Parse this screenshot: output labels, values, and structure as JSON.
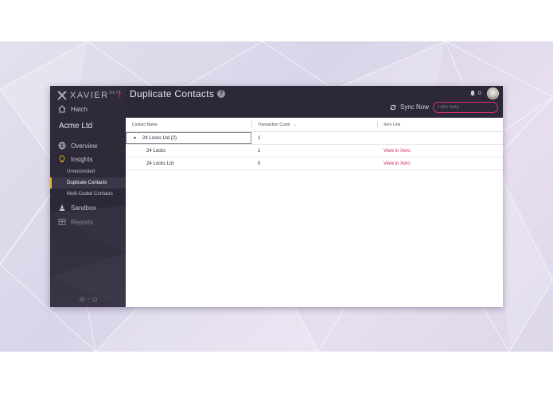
{
  "brand": {
    "name": "XAVIER",
    "badge": "BETA",
    "collapse_glyph": "‹"
  },
  "sidebar": {
    "home": {
      "label": "Hatch",
      "icon": "home-icon"
    },
    "org_name": "Acme Ltd",
    "overview": {
      "label": "Overview",
      "icon": "globe-icon"
    },
    "insights": {
      "label": "Insights",
      "icon": "lightbulb-icon",
      "children": [
        {
          "label": "Unreconciled",
          "active": false
        },
        {
          "label": "Duplicate Contacts",
          "active": true
        },
        {
          "label": "Multi-Coded Contacts",
          "active": false
        }
      ]
    },
    "sandbox": {
      "label": "Sandbox",
      "icon": "sandbox-icon"
    },
    "reports": {
      "label": "Reports",
      "icon": "table-icon"
    }
  },
  "header": {
    "title": "Duplicate Contacts",
    "notification_count": "0",
    "sync_label": "Sync Now",
    "filter_placeholder": "Filter data"
  },
  "table": {
    "columns": [
      "Contact Name",
      "Transaction Count",
      "Xero Link"
    ],
    "sort_glyph": "↓",
    "group": {
      "name": "24 Locks Ltd (2)",
      "count": "1"
    },
    "rows": [
      {
        "name": "24 Locks",
        "count": "1",
        "link": "View in Xero"
      },
      {
        "name": "24 Locks Ltd",
        "count": "0",
        "link": "View in Xero"
      }
    ]
  },
  "colors": {
    "accent": "#e0306e",
    "sidebar_bg": "#2c2837",
    "active_marker": "#e6b12e",
    "link": "#d0245f"
  }
}
